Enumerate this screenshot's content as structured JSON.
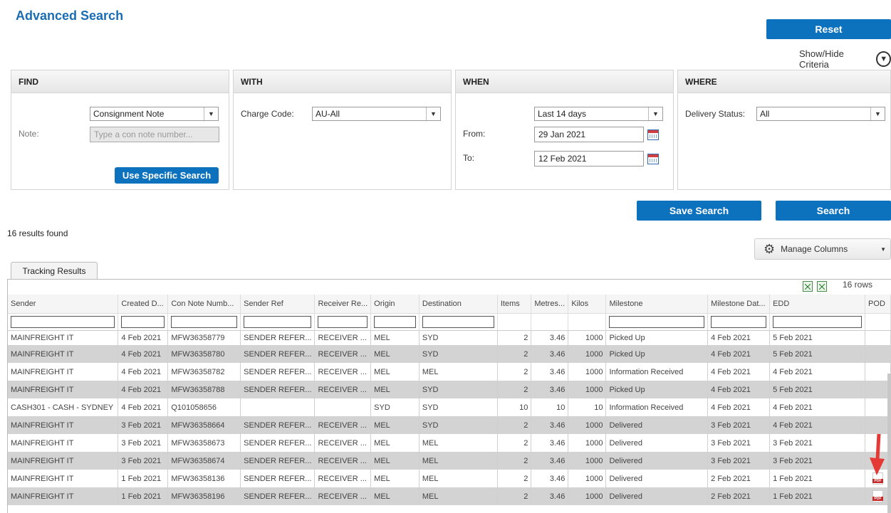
{
  "page": {
    "title": "Advanced Search"
  },
  "actions": {
    "reset": "Reset",
    "show_hide": "Show/Hide Criteria",
    "save_search": "Save Search",
    "search": "Search"
  },
  "find": {
    "heading": "FIND",
    "type_value": "Consignment Note",
    "note_label": "Note:",
    "note_placeholder": "Type a con note number...",
    "specific_button": "Use Specific Search"
  },
  "with": {
    "heading": "WITH",
    "charge_label": "Charge Code:",
    "charge_value": "AU-All"
  },
  "when": {
    "heading": "WHEN",
    "range_value": "Last 14 days",
    "from_label": "From:",
    "from_value": "29 Jan 2021",
    "to_label": "To:",
    "to_value": "12 Feb 2021"
  },
  "where": {
    "heading": "WHERE",
    "status_label": "Delivery Status:",
    "status_value": "All"
  },
  "results": {
    "count_text": "16 results found",
    "manage_columns": "Manage Columns",
    "tab": "Tracking Results",
    "rows_text": "16 rows",
    "columns": [
      "Sender",
      "Created D...",
      "Con Note Numb...",
      "Sender Ref",
      "Receiver Re...",
      "Origin",
      "Destination",
      "Items",
      "Metres...",
      "Kilos",
      "Milestone",
      "Milestone Dat...",
      "EDD",
      "POD"
    ],
    "rows": [
      [
        "MAINFREIGHT IT",
        "4 Feb 2021",
        "MFW36358779",
        "SENDER REFER...",
        "RECEIVER ...",
        "MEL",
        "SYD",
        "2",
        "3.46",
        "1000",
        "Picked Up",
        "4 Feb 2021",
        "5 Feb 2021"
      ],
      [
        "MAINFREIGHT IT",
        "4 Feb 2021",
        "MFW36358780",
        "SENDER REFER...",
        "RECEIVER ...",
        "MEL",
        "SYD",
        "2",
        "3.46",
        "1000",
        "Picked Up",
        "4 Feb 2021",
        "5 Feb 2021"
      ],
      [
        "MAINFREIGHT IT",
        "4 Feb 2021",
        "MFW36358782",
        "SENDER REFER...",
        "RECEIVER ...",
        "MEL",
        "MEL",
        "2",
        "3.46",
        "1000",
        "Information Received",
        "4 Feb 2021",
        "4 Feb 2021"
      ],
      [
        "MAINFREIGHT IT",
        "4 Feb 2021",
        "MFW36358788",
        "SENDER REFER...",
        "RECEIVER ...",
        "MEL",
        "SYD",
        "2",
        "3.46",
        "1000",
        "Picked Up",
        "4 Feb 2021",
        "5 Feb 2021"
      ],
      [
        "CASH301 - CASH - SYDNEY",
        "4 Feb 2021",
        "Q101058656",
        "",
        "",
        "SYD",
        "SYD",
        "10",
        "10",
        "10",
        "Information Received",
        "4 Feb 2021",
        "4 Feb 2021"
      ],
      [
        "MAINFREIGHT IT",
        "3 Feb 2021",
        "MFW36358664",
        "SENDER REFER...",
        "RECEIVER ...",
        "MEL",
        "SYD",
        "2",
        "3.46",
        "1000",
        "Delivered",
        "3 Feb 2021",
        "4 Feb 2021"
      ],
      [
        "MAINFREIGHT IT",
        "3 Feb 2021",
        "MFW36358673",
        "SENDER REFER...",
        "RECEIVER ...",
        "MEL",
        "MEL",
        "2",
        "3.46",
        "1000",
        "Delivered",
        "3 Feb 2021",
        "3 Feb 2021"
      ],
      [
        "MAINFREIGHT IT",
        "3 Feb 2021",
        "MFW36358674",
        "SENDER REFER...",
        "RECEIVER ...",
        "MEL",
        "MEL",
        "2",
        "3.46",
        "1000",
        "Delivered",
        "3 Feb 2021",
        "3 Feb 2021"
      ],
      [
        "MAINFREIGHT IT",
        "1 Feb 2021",
        "MFW36358136",
        "SENDER REFER...",
        "RECEIVER ...",
        "MEL",
        "MEL",
        "2",
        "3.46",
        "1000",
        "Delivered",
        "2 Feb 2021",
        "1 Feb 2021"
      ],
      [
        "MAINFREIGHT IT",
        "1 Feb 2021",
        "MFW36358196",
        "SENDER REFER...",
        "RECEIVER ...",
        "MEL",
        "MEL",
        "2",
        "3.46",
        "1000",
        "Delivered",
        "2 Feb 2021",
        "1 Feb 2021"
      ]
    ],
    "pod_rows": [
      8,
      9
    ]
  },
  "icons": {
    "show_hide": "chevron-down-circle-icon",
    "calendar": "calendar-icon",
    "settings": "gear-icon",
    "export": "excel-export-icon",
    "pod": "pdf-icon",
    "annotation": "red-arrow-icon"
  },
  "colors": {
    "accent": "#0d72be",
    "title": "#1a6db3",
    "alt_row": "#d3d3d3",
    "arrow": "#e53935"
  }
}
